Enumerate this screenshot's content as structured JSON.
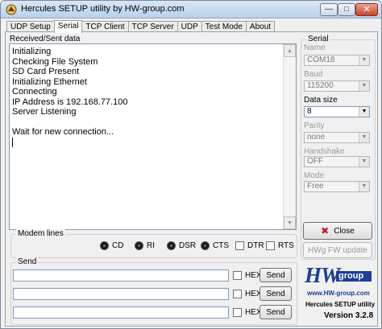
{
  "window": {
    "title": "Hercules SETUP utility by HW-group.com",
    "min_glyph": "—",
    "max_glyph": "□",
    "close_glyph": "✕"
  },
  "tabs": [
    {
      "label": "UDP Setup"
    },
    {
      "label": "Serial",
      "active": true
    },
    {
      "label": "TCP Client"
    },
    {
      "label": "TCP Server"
    },
    {
      "label": "UDP"
    },
    {
      "label": "Test Mode"
    },
    {
      "label": "About"
    }
  ],
  "received": {
    "label": "Received/Sent data",
    "text": "Initializing\nChecking File System\nSD Card Present\nInitializing Ethernet\nConnecting\nIP Address is 192.168.77.100\nServer Listening\n\nWait for new connection..."
  },
  "serial": {
    "group_label": "Serial",
    "name_label": "Name",
    "name_value": "COM18",
    "baud_label": "Baud",
    "baud_value": "115200",
    "datasize_label": "Data size",
    "datasize_value": "8",
    "parity_label": "Parity",
    "parity_value": "none",
    "handshake_label": "Handshake",
    "handshake_value": "OFF",
    "mode_label": "Mode",
    "mode_value": "Free",
    "close_label": "Close",
    "hwg_fw_label": "HWg FW update"
  },
  "modem": {
    "group_label": "Modem lines",
    "cd": "CD",
    "ri": "RI",
    "dsr": "DSR",
    "cts": "CTS",
    "dtr": "DTR",
    "rts": "RTS"
  },
  "send": {
    "group_label": "Send",
    "hex_label": "HEX",
    "send_label": "Send",
    "rows": [
      {
        "value": ""
      },
      {
        "value": ""
      },
      {
        "value": ""
      }
    ]
  },
  "logo": {
    "hw": "HW",
    "group": "group",
    "url": "www.HW-group.com",
    "app": "Hercules SETUP utility",
    "version": "Version  3.2.8"
  },
  "colors": {
    "brand_blue": "#1d3f95",
    "close_x_red": "#c62020"
  }
}
